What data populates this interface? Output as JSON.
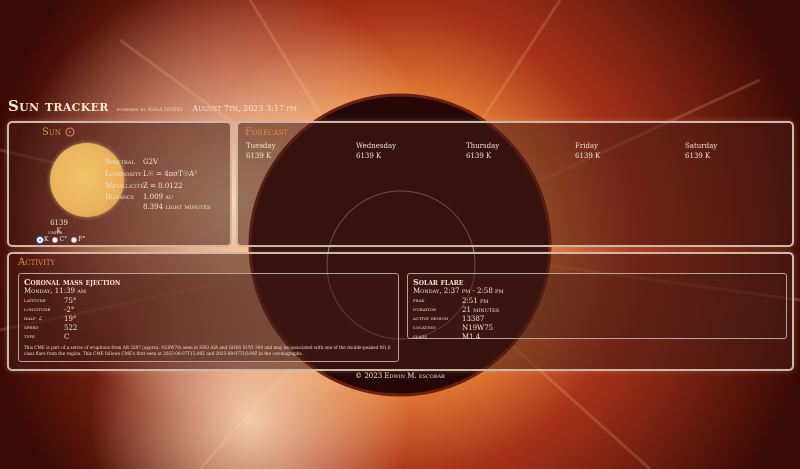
{
  "header": {
    "title": "Sun tracker",
    "powered": "powered by NASA DONKI",
    "date": "August 7th, 2023 3:17 pm"
  },
  "sun": {
    "title": "Sun",
    "temperature": "6139 K",
    "units_label": "units",
    "units": [
      {
        "label": "K",
        "selected": true
      },
      {
        "label": "C°",
        "selected": false
      },
      {
        "label": "F°",
        "selected": false
      }
    ],
    "stats": {
      "spectral_label": "Spectral",
      "spectral_value": "G2V",
      "luminosity_label": "Luminosity",
      "luminosity_value": "L☉ = 4πσT☉A²",
      "metallicity_label": "Metallicity",
      "metallicity_value": "Z = 0.0122",
      "distance_label": "Distance",
      "distance_value": "1.009 au",
      "distance_value2": "8.394 light minutes"
    }
  },
  "forecast": {
    "title": "Forecast",
    "days": [
      {
        "day": "Tuesday",
        "temp": "6139 K"
      },
      {
        "day": "Wednesday",
        "temp": "6139 K"
      },
      {
        "day": "Thursday",
        "temp": "6139 K"
      },
      {
        "day": "Friday",
        "temp": "6139 K"
      },
      {
        "day": "Saturday",
        "temp": "6139 K"
      }
    ]
  },
  "activity": {
    "title": "Activity",
    "cme": {
      "title": "Coronal mass ejection",
      "time": "Monday, 11:39 am",
      "rows": [
        {
          "k": "latitude",
          "v": "75°"
        },
        {
          "k": "longitude",
          "v": "-2°"
        },
        {
          "k": "half ∠",
          "v": "19°"
        },
        {
          "k": "speed",
          "v": "522"
        },
        {
          "k": "type",
          "v": "C"
        }
      ],
      "description": "This CME is part of a series of eruptions from AR 3387 (approx. N20W70) seen in SDO AIA and GOES SUVI 304 and may be associated with one of the double-peaked M1.0 class flare from the region. This CME follows CME's first seen at 2023-08-07T15:09Z and 2023-08-07T16:09Z in the coronagraphs."
    },
    "flare": {
      "title": "Solar flare",
      "time": "Monday, 2:37 pm - 2:58 pm",
      "rows": [
        {
          "k": "peak",
          "v": "2:51 pm"
        },
        {
          "k": "duration",
          "v": "21 minutes"
        },
        {
          "k": "active region",
          "v": "13387"
        },
        {
          "k": "location",
          "v": "N19W75"
        },
        {
          "k": "class",
          "v": "M1.4"
        }
      ]
    }
  },
  "footer": "© 2023 Edwin M. escobar",
  "colors": {
    "accent": "#e68a48",
    "sun_disc": "#eab25a",
    "panel_border": "#cdb7a6"
  },
  "icons": {
    "sun_title_icon": "sun-icon"
  }
}
